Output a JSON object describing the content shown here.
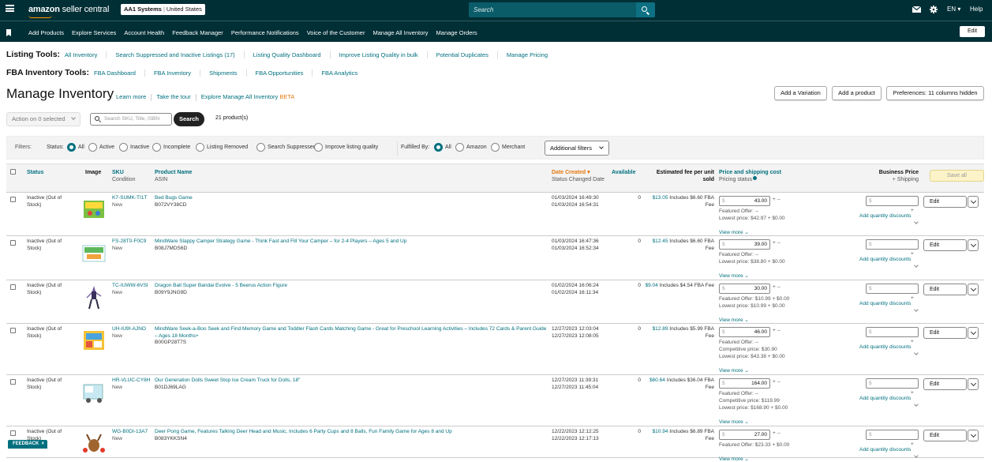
{
  "header": {
    "logo_prefix": "amazon",
    "logo_suffix": "seller central",
    "account_name": "AA1 Systems",
    "account_region": "United States",
    "search_placeholder": "Search",
    "language": "EN",
    "help": "Help"
  },
  "nav": {
    "items": [
      "Add Products",
      "Explore Services",
      "Account Health",
      "Feedback Manager",
      "Performance Notifications",
      "Voice of the Customer",
      "Manage All Inventory",
      "Manage Orders"
    ],
    "edit_label": "Edit"
  },
  "listing_tools": {
    "label": "Listing Tools:",
    "links": [
      "All Inventory",
      "Search Suppressed and Inactive Listings (17)",
      "Listing Quality Dashboard",
      "Improve Listing Quality in bulk",
      "Potential Duplicates",
      "Manage Pricing"
    ]
  },
  "fba_tools": {
    "label": "FBA Inventory Tools:",
    "links": [
      "FBA Dashboard",
      "FBA Inventory",
      "Shipments",
      "FBA Opportunities",
      "FBA Analytics"
    ]
  },
  "page": {
    "title": "Manage Inventory",
    "learn_more": "Learn more",
    "take_tour": "Take the tour",
    "explore": "Explore Manage All Inventory",
    "beta": "BETA",
    "add_variation": "Add a Variation",
    "add_product": "Add a product",
    "preferences": "Preferences: 11 columns hidden"
  },
  "toolbar": {
    "action_label": "Action on 0 selected",
    "search_placeholder": "Search SKU, Title, ISBN",
    "search_button": "Search",
    "product_count": "21 product(s)"
  },
  "filters": {
    "label": "Filters:",
    "status_label": "Status:",
    "status_options": [
      "All",
      "Active",
      "Inactive",
      "Incomplete",
      "Listing Removed",
      "Search Suppressed",
      "Improve listing quality"
    ],
    "status_selected": "All",
    "fulfilled_label": "Fulfilled By:",
    "fulfilled_options": [
      "All",
      "Amazon",
      "Merchant"
    ],
    "fulfilled_selected": "All",
    "additional": "Additional filters"
  },
  "table": {
    "headers": {
      "status": "Status",
      "image": "Image",
      "sku": "SKU",
      "condition": "Condition",
      "product_name": "Product Name",
      "asin": "ASIN",
      "date_created": "Date Created",
      "status_changed": "Status Changed Date",
      "available": "Available",
      "fee_line1": "Estimated fee per unit",
      "fee_line2": "sold",
      "price": "Price and shipping cost",
      "pricing_status": "Pricing status",
      "business_price": "Business Price",
      "shipping": "+ Shipping",
      "save_all": "Save all"
    },
    "common": {
      "currency": "$",
      "plus_dash": "+ --",
      "plus": "+",
      "view_more": "View more",
      "add_qty_discounts": "Add quantity discounts",
      "edit": "Edit"
    },
    "rows": [
      {
        "status": "Inactive (Out of Stock)",
        "sku": "K7-SUMK-TI1T",
        "condition": "New",
        "name": "Bed Bugs Game",
        "asin": "B072VY38CD",
        "created": "01/03/2024 16:49:30",
        "changed": "01/03/2024 16:54:31",
        "available": "0",
        "fee": "$13.05",
        "fee_detail": "Includes $6.60 FBA Fee",
        "price": "43.00",
        "pricing": [
          "Featured Offer: --",
          "Lowest price: $42.97 + $0.00"
        ]
      },
      {
        "status": "Inactive (Out of Stock)",
        "sku": "FS-28T0-F0C9",
        "condition": "New",
        "name": "MindWare Slappy Camper Strategy Game - Think Fast and Fill Your Camper – for 2-4 Players – Ages 5 and Up",
        "asin": "B08J7MDS6D",
        "created": "01/03/2024 16:47:36",
        "changed": "01/03/2024 16:52:34",
        "available": "0",
        "fee": "$12.45",
        "fee_detail": "Includes $6.60 FBA Fee",
        "price": "39.00",
        "pricing": [
          "Featured Offer: --",
          "Lowest price: $38.80 + $0.00"
        ]
      },
      {
        "status": "Inactive (Out of Stock)",
        "sku": "TC-IUWW-6VSI",
        "condition": "New",
        "name": "Dragon Ball Super Bandai Evolve - 5 Beerus Action Figure",
        "asin": "B09Y9JNG9D",
        "created": "01/02/2024 16:06:24",
        "changed": "01/02/2024 16:11:34",
        "available": "0",
        "fee": "$9.04",
        "fee_detail": "Includes $4.54 FBA Fee",
        "price": "30.00",
        "pricing": [
          "Featured Offer: $10.99 + $0.00",
          "Lowest price: $10.99 + $0.00"
        ]
      },
      {
        "status": "Inactive (Out of Stock)",
        "sku": "UH-IU9I-AJNO",
        "condition": "New",
        "name": "MindWare Seek-a-Boo Seek and Find Memory Game and Toddler Flash Cards Matching Game - Great for Preschool Learning Activities – Includes 72 Cards & Parent Guide – Ages 18 Months+",
        "asin": "B00GP28T7S",
        "created": "12/27/2023 12:03:04",
        "changed": "12/27/2023 12:08:05",
        "available": "0",
        "fee": "$12.89",
        "fee_detail": "Includes $5.99 FBA Fee",
        "price": "46.00",
        "pricing": [
          "Featured Offer: --",
          "Competitive price: $30.90",
          "Lowest price: $43.38 + $0.00"
        ]
      },
      {
        "status": "Inactive (Out of Stock)",
        "sku": "HR-VLUC-CY8H",
        "condition": "New",
        "name": "Our Generation Dolls Sweet Stop Ice Cream Truck for Dolls, 18\"",
        "asin": "B01DJ69LAG",
        "created": "12/27/2023 11:39:31",
        "changed": "12/27/2023 11:45:04",
        "available": "0",
        "fee": "$60.64",
        "fee_detail": "Includes $36.04 FBA Fee",
        "price": "164.00",
        "pricing": [
          "Featured Offer: --",
          "Competitive price: $119.99",
          "Lowest price: $168.90 + $0.00"
        ]
      },
      {
        "status": "Inactive (Out of Stock)",
        "sku": "WG-B0DI-13A7",
        "condition": "New",
        "name": "Deer Pong Game, Features Talking Deer Head and Music, Includes 6 Party Cups and 8 Balls, Fun Family Game for Ages 8 and Up",
        "asin": "B083YKKSN4",
        "created": "12/22/2023 12:12:25",
        "changed": "12/22/2023 12:17:13",
        "available": "0",
        "fee": "$10.94",
        "fee_detail": "Includes $6.89 FBA Fee",
        "price": "27.00",
        "pricing": [
          "Featured Offer: $23.33 + $0.00"
        ]
      }
    ]
  },
  "feedback": {
    "label": "FEEDBACK",
    "close": "×"
  },
  "colors": {
    "header_bg": "#002f36",
    "link": "#00707f",
    "accent_orange": "#e47911"
  }
}
